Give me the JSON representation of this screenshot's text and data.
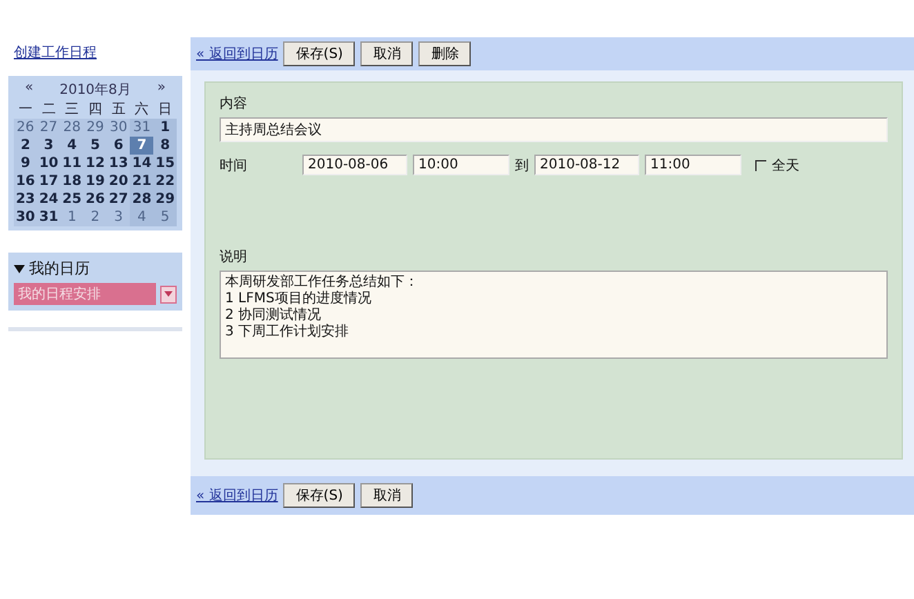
{
  "create_link": "创建工作日程",
  "calendar": {
    "prev": "«",
    "title": "2010年8月",
    "next": "»",
    "weekdays": [
      "一",
      "二",
      "三",
      "四",
      "五",
      "六",
      "日"
    ],
    "weeks": [
      [
        {
          "d": "26",
          "muted": true,
          "selected": false
        },
        {
          "d": "27",
          "muted": true,
          "selected": false
        },
        {
          "d": "28",
          "muted": true,
          "selected": false
        },
        {
          "d": "29",
          "muted": true,
          "selected": false
        },
        {
          "d": "30",
          "muted": true,
          "selected": false
        },
        {
          "d": "31",
          "muted": true,
          "selected": false
        },
        {
          "d": "1",
          "muted": false,
          "selected": false
        }
      ],
      [
        {
          "d": "2",
          "muted": false,
          "selected": false
        },
        {
          "d": "3",
          "muted": false,
          "selected": false
        },
        {
          "d": "4",
          "muted": false,
          "selected": false
        },
        {
          "d": "5",
          "muted": false,
          "selected": false
        },
        {
          "d": "6",
          "muted": false,
          "selected": false
        },
        {
          "d": "7",
          "muted": false,
          "selected": true
        },
        {
          "d": "8",
          "muted": false,
          "selected": false
        }
      ],
      [
        {
          "d": "9",
          "muted": false,
          "selected": false
        },
        {
          "d": "10",
          "muted": false,
          "selected": false
        },
        {
          "d": "11",
          "muted": false,
          "selected": false
        },
        {
          "d": "12",
          "muted": false,
          "selected": false
        },
        {
          "d": "13",
          "muted": false,
          "selected": false
        },
        {
          "d": "14",
          "muted": false,
          "selected": false
        },
        {
          "d": "15",
          "muted": false,
          "selected": false
        }
      ],
      [
        {
          "d": "16",
          "muted": false,
          "selected": false
        },
        {
          "d": "17",
          "muted": false,
          "selected": false
        },
        {
          "d": "18",
          "muted": false,
          "selected": false
        },
        {
          "d": "19",
          "muted": false,
          "selected": false
        },
        {
          "d": "20",
          "muted": false,
          "selected": false
        },
        {
          "d": "21",
          "muted": false,
          "selected": false
        },
        {
          "d": "22",
          "muted": false,
          "selected": false
        }
      ],
      [
        {
          "d": "23",
          "muted": false,
          "selected": false
        },
        {
          "d": "24",
          "muted": false,
          "selected": false
        },
        {
          "d": "25",
          "muted": false,
          "selected": false
        },
        {
          "d": "26",
          "muted": false,
          "selected": false
        },
        {
          "d": "27",
          "muted": false,
          "selected": false
        },
        {
          "d": "28",
          "muted": false,
          "selected": false
        },
        {
          "d": "29",
          "muted": false,
          "selected": false
        }
      ],
      [
        {
          "d": "30",
          "muted": false,
          "selected": false
        },
        {
          "d": "31",
          "muted": false,
          "selected": false
        },
        {
          "d": "1",
          "muted": true,
          "selected": false
        },
        {
          "d": "2",
          "muted": true,
          "selected": false
        },
        {
          "d": "3",
          "muted": true,
          "selected": false
        },
        {
          "d": "4",
          "muted": true,
          "selected": false
        },
        {
          "d": "5",
          "muted": true,
          "selected": false
        }
      ]
    ]
  },
  "my_calendars": {
    "title": "我的日历",
    "expanded": true,
    "select_value": "我的日程安排"
  },
  "top_toolbar": {
    "back_link": "« 返回到日历",
    "buttons": [
      "保存(S)",
      "取消",
      "删除"
    ]
  },
  "form": {
    "content_label": "内容",
    "content_value": "主持周总结会议",
    "time_label": "时间",
    "start_date": "2010-08-06",
    "start_time": "10:00",
    "to_label": "到",
    "end_date": "2010-08-12",
    "end_time": "11:00",
    "all_day": {
      "label": "全天",
      "checked": false
    },
    "description_label": "说明",
    "description_lines": [
      "本周研发部工作任务总结如下：",
      "1 LFMS项目的进度情况",
      "2 协同测试情况",
      "3 下周工作计划安排"
    ]
  },
  "bottom_toolbar": {
    "back_link": "« 返回到日历",
    "buttons": [
      "保存(S)",
      "取消"
    ]
  }
}
